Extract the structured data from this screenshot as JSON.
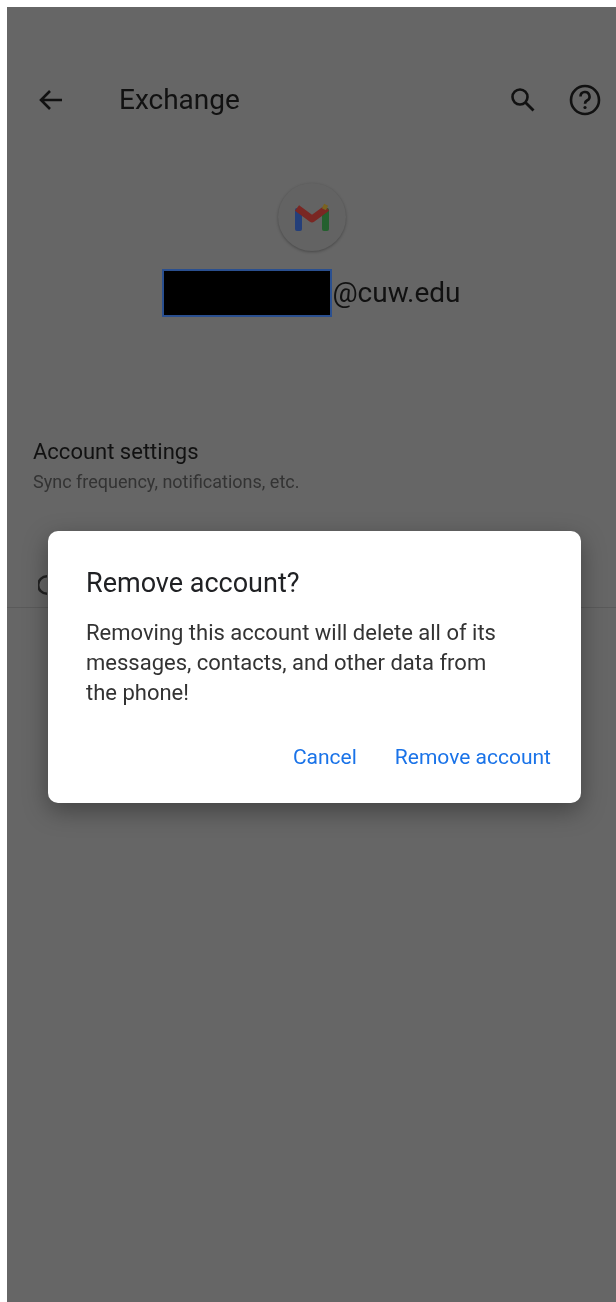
{
  "app_bar": {
    "title": "Exchange"
  },
  "account": {
    "email_suffix": "@cuw.edu"
  },
  "settings": [
    {
      "title": "Account settings",
      "subtitle": "Sync frequency, notifications, etc."
    }
  ],
  "dialog": {
    "title": "Remove account?",
    "message": "Removing this account will delete all of its messages, contacts, and other data from the phone!",
    "buttons": [
      "Cancel",
      "Remove account"
    ]
  }
}
